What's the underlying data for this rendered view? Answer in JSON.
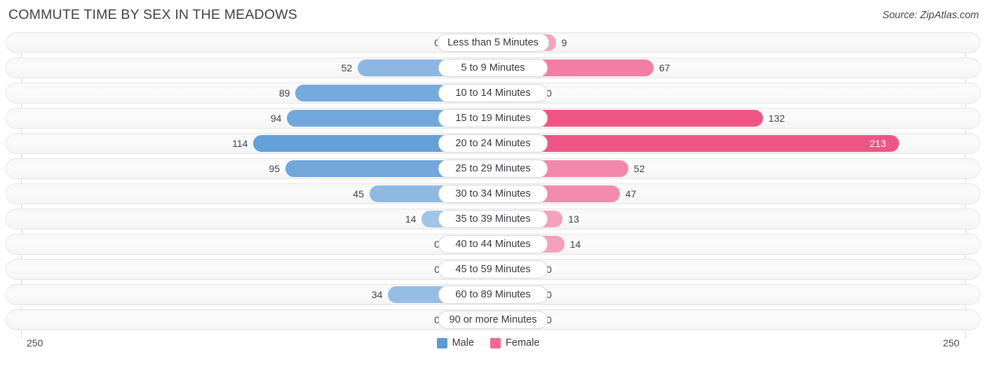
{
  "header": {
    "title": "COMMUTE TIME BY SEX IN THE MEADOWS",
    "source": "Source: ZipAtlas.com"
  },
  "legend": {
    "items": [
      {
        "label": "Male",
        "color": "#5b9bd5"
      },
      {
        "label": "Female",
        "color": "#f2688f"
      }
    ]
  },
  "axis": {
    "left_label": "250",
    "right_label": "250"
  },
  "chart_data": {
    "type": "bar",
    "title": "COMMUTE TIME BY SEX IN THE MEADOWS",
    "subtitle": "Source: ZipAtlas.com",
    "orientation": "horizontal",
    "style": "diverging-bidirectional",
    "xlabel": "",
    "ylabel": "",
    "axis_max": 250,
    "xlim": [
      250,
      250
    ],
    "grid": true,
    "legend_position": "bottom-center",
    "categories": [
      "Less than 5 Minutes",
      "5 to 9 Minutes",
      "10 to 14 Minutes",
      "15 to 19 Minutes",
      "20 to 24 Minutes",
      "25 to 29 Minutes",
      "30 to 34 Minutes",
      "35 to 39 Minutes",
      "40 to 44 Minutes",
      "45 to 59 Minutes",
      "60 to 89 Minutes",
      "90 or more Minutes"
    ],
    "series": [
      {
        "name": "Male",
        "color": "#5b9bd5",
        "side": "left",
        "values": [
          0,
          52,
          89,
          94,
          114,
          95,
          45,
          14,
          0,
          0,
          34,
          0
        ]
      },
      {
        "name": "Female",
        "color": "#f2688f",
        "side": "right",
        "values": [
          9,
          67,
          0,
          132,
          213,
          52,
          47,
          13,
          14,
          0,
          0,
          0
        ]
      }
    ]
  }
}
